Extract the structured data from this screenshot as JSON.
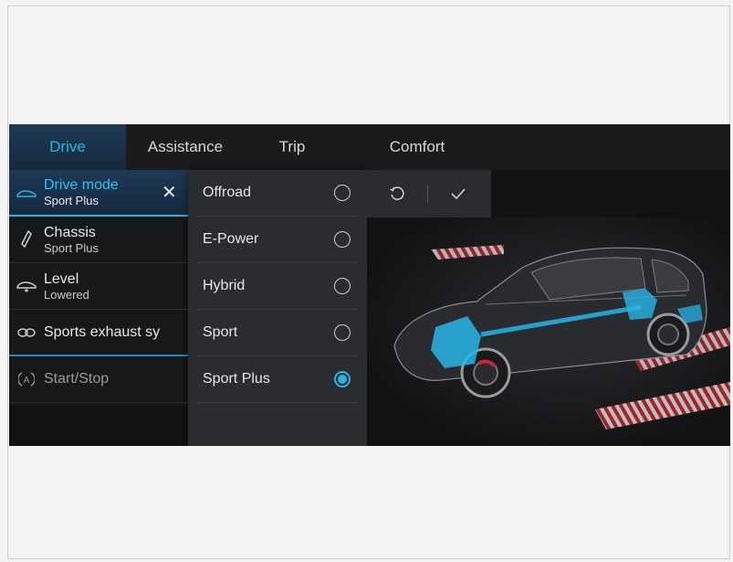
{
  "tabs": [
    {
      "label": "Drive"
    },
    {
      "label": "Assistance"
    },
    {
      "label": "Trip"
    },
    {
      "label": "Comfort"
    }
  ],
  "list": {
    "items": [
      {
        "title": "Drive mode",
        "subtitle": "Sport Plus",
        "icon": "car-icon"
      },
      {
        "title": "Chassis",
        "subtitle": "Sport Plus",
        "icon": "shock-absorber-icon"
      },
      {
        "title": "Level",
        "subtitle": "Lowered",
        "icon": "car-level-icon"
      },
      {
        "title": "Sports exhaust sy",
        "subtitle": "",
        "icon": "exhaust-icon"
      },
      {
        "title": "Start/Stop",
        "subtitle": "",
        "icon": "auto-start-stop-icon"
      }
    ],
    "close_icon": "close-icon"
  },
  "options": {
    "items": [
      {
        "label": "Offroad",
        "selected": false
      },
      {
        "label": "E-Power",
        "selected": false
      },
      {
        "label": "Hybrid",
        "selected": false
      },
      {
        "label": "Sport",
        "selected": false
      },
      {
        "label": "Sport Plus",
        "selected": true
      }
    ]
  },
  "actions": {
    "reset_icon": "reset-icon",
    "confirm_icon": "checkmark-icon"
  },
  "colors": {
    "accent": "#27b5e8",
    "background": "#111214",
    "panel": "#2b2c2f"
  }
}
